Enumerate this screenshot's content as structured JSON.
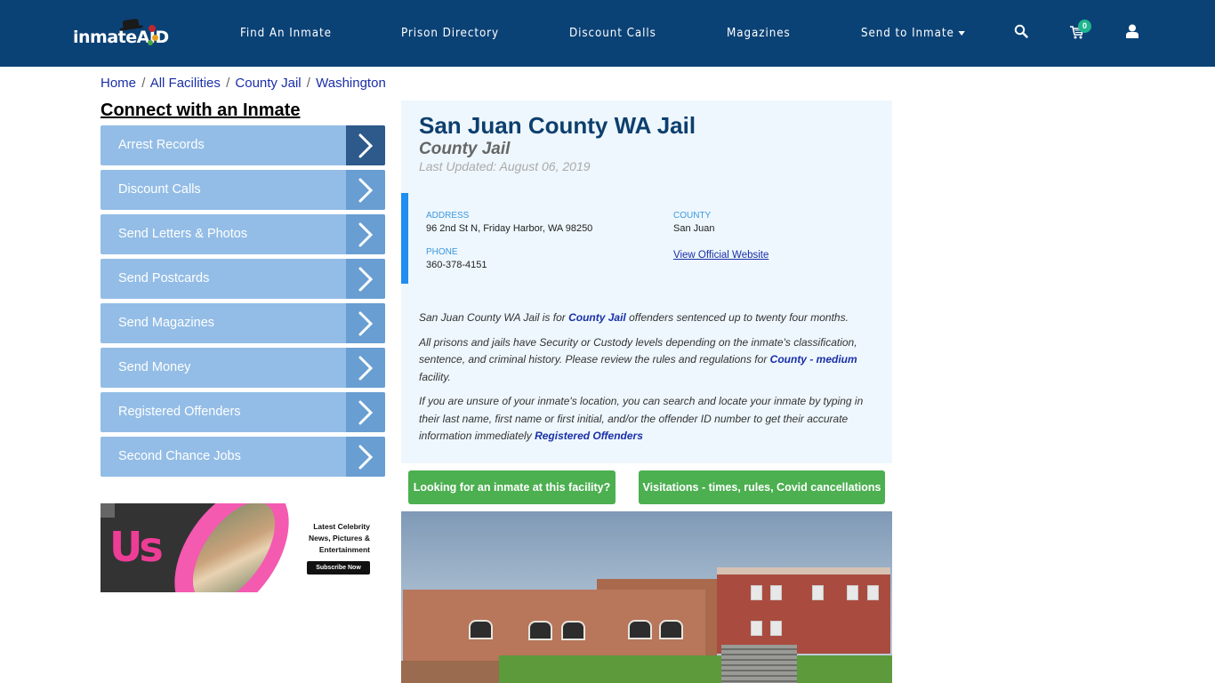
{
  "header": {
    "logo_text": "inmateAID",
    "nav": [
      {
        "label": "Find An Inmate"
      },
      {
        "label": "Prison Directory"
      },
      {
        "label": "Discount Calls"
      },
      {
        "label": "Magazines"
      },
      {
        "label": "Send to Inmate",
        "dropdown": true
      }
    ],
    "icons": {
      "search": "search-icon",
      "cart": "cart-icon",
      "user": "user-icon"
    },
    "cart_count": "0"
  },
  "breadcrumb": [
    {
      "label": "Home"
    },
    {
      "label": "All Facilities"
    },
    {
      "label": "County Jail"
    },
    {
      "label": "Washington"
    }
  ],
  "breadcrumb_separator": "/",
  "sidebar": {
    "title": "Connect with an Inmate",
    "items": [
      {
        "label": "Arrest Records",
        "active": true
      },
      {
        "label": "Discount Calls"
      },
      {
        "label": "Send Letters & Photos"
      },
      {
        "label": "Send Postcards"
      },
      {
        "label": "Send Magazines"
      },
      {
        "label": "Send Money"
      },
      {
        "label": "Registered Offenders"
      },
      {
        "label": "Second Chance Jobs"
      }
    ],
    "ad": {
      "brand": "Us",
      "text_line1": "Latest Celebrity",
      "text_line2": "News, Pictures &",
      "text_line3": "Entertainment",
      "button": "Subscribe Now"
    }
  },
  "facility": {
    "title": "San Juan County WA Jail",
    "type": "County Jail",
    "last_updated": "Last Updated: August 06, 2019",
    "address_label": "ADDRESS",
    "address": "96 2nd St N, Friday Harbor, WA 98250",
    "county_label": "COUNTY",
    "county": "San Juan",
    "phone_label": "PHONE",
    "phone": "360-378-4151",
    "website_link": "View Official Website"
  },
  "description": {
    "p1_pre": "San Juan County WA Jail is for ",
    "p1_link": "County Jail",
    "p1_post": " offenders sentenced up to twenty four months.",
    "p2_pre": "All prisons and jails have Security or Custody levels depending on the inmate's classification, sentence, and criminal history. Please review the rules and regulations for ",
    "p2_link": "County - medium",
    "p2_post": " facility.",
    "p3_pre": "If you are unsure of your inmate's location, you can search and locate your inmate by typing in their last name, first name or first initial, and/or the offender ID number to get their accurate information immediately ",
    "p3_link": "Registered Offenders"
  },
  "actions": {
    "find_inmate": "Looking for an inmate at this facility?",
    "visitations": "Visitations - times, rules, Covid cancellations"
  },
  "colors": {
    "header_bg": "#0b4276",
    "sidebar_item": "#93bde6",
    "sidebar_arrow": "#689ed2",
    "sidebar_arrow_active": "#2d5a8a",
    "panel_bg": "#eef7fd",
    "accent_bar": "#1e8ef0",
    "title": "#0d3f6e",
    "link": "#1a2fa8",
    "button_green": "#4caf50",
    "badge": "#1fb58f"
  }
}
